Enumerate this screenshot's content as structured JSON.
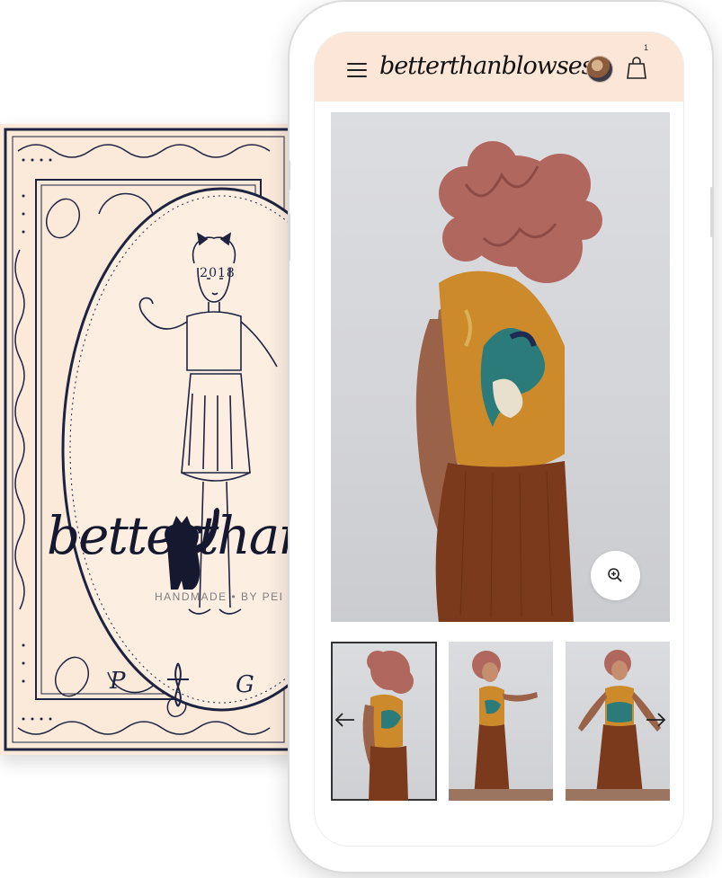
{
  "card": {
    "year": "2018",
    "script_title": "betterthanblouses",
    "tagline": "HANDMADE • BY PEI",
    "monogram_left": "P",
    "monogram_right": "G",
    "colors": {
      "background": "#fbe9da",
      "ink": "#1e2340"
    }
  },
  "header": {
    "logo": "betterthanblowses",
    "menu_icon": "hamburger-icon",
    "cart_icon": "shopping-bag-icon",
    "cart_count": "1",
    "background": "#fbe6d7"
  },
  "product": {
    "zoom_icon": "zoom-in-icon",
    "prev_icon": "arrow-left-icon",
    "next_icon": "arrow-right-icon",
    "thumbnail_count": 3
  }
}
